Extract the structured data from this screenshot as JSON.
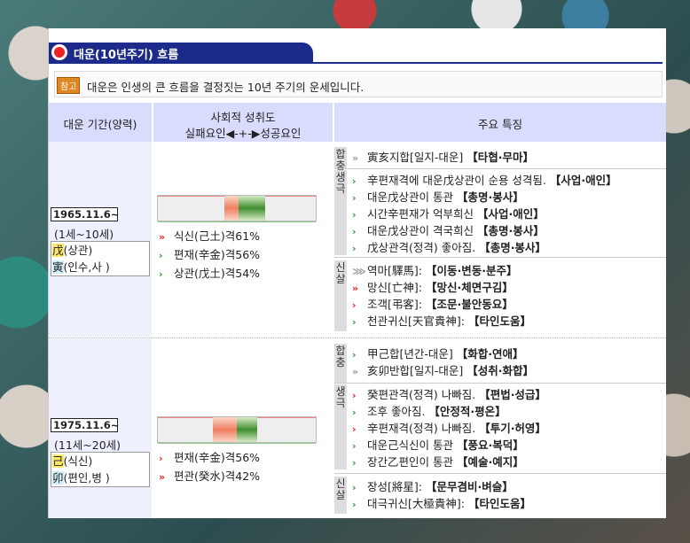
{
  "header": {
    "title": "대운(10년주기) 흐름",
    "notice_tag": "참고",
    "notice_text": "대운은 인생의 큰 흐름을 결정짓는 10년 주기의 운세입니다."
  },
  "columns": {
    "period": "대운 기간(양력)",
    "social_line1": "사회적 성취도",
    "social_line2": "실패요인◀-+-▶성공요인",
    "features": "주요 특징"
  },
  "rows": [
    {
      "date": "1965.11.6~",
      "age": "(1세~10세)",
      "gan_char": "戊",
      "gan_rest": "(상관)",
      "ji_char": "寅",
      "ji_rest": "(인수,사 )",
      "bar": {
        "red_start": 0.42,
        "red_end": 0.51,
        "green_end": 0.68
      },
      "metrics": [
        {
          "arrow": "double-red",
          "text": "식신(己土)격61%"
        },
        {
          "arrow": "green",
          "text": "편재(辛金)격56%"
        },
        {
          "arrow": "green",
          "text": "상관(戊土)격54%"
        }
      ],
      "groups": [
        {
          "label": "합충",
          "items": [
            {
              "arrow": "gray-double",
              "text": "寅亥지합[일지-대운] ",
              "bold": "【타협·무마】"
            }
          ]
        },
        {
          "label": "생극",
          "items": [
            {
              "arrow": "green",
              "text": "辛편재격에 대운戊상관이 순용 성격됨. ",
              "bold": "【사업·애인】"
            },
            {
              "arrow": "green",
              "text": "대운戊상관이 통관 ",
              "bold": "【총명·봉사】"
            },
            {
              "arrow": "green",
              "text": "시간辛편재가 억부희신 ",
              "bold": "【사업·애인】"
            },
            {
              "arrow": "green",
              "text": "대운戊상관이 격국희신 ",
              "bold": "【총명·봉사】"
            },
            {
              "arrow": "green",
              "text": "戊상관격(정격) 좋아짐. ",
              "bold": "【총명·봉사】"
            }
          ]
        },
        {
          "label": "신살",
          "items": [
            {
              "arrow": "gray-triple",
              "text": "역마[驛馬]: ",
              "bold": "【이동·변동·분주】"
            },
            {
              "arrow": "double-red",
              "text": "망신[亡神]: ",
              "bold": "【망신·체면구김】"
            },
            {
              "arrow": "red",
              "text": "조객[弔客]: ",
              "bold": "【조문·불안동요】"
            },
            {
              "arrow": "green",
              "text": "천관귀신[天官貴神]: ",
              "bold": "【타인도움】"
            }
          ]
        }
      ]
    },
    {
      "date": "1975.11.6~",
      "age": "(11세~20세)",
      "gan_char": "己",
      "gan_rest": "(식신)",
      "ji_char": "卯",
      "ji_rest": "(편인,병 )",
      "bar": {
        "red_start": 0.35,
        "red_end": 0.5,
        "green_end": 0.63
      },
      "metrics": [
        {
          "arrow": "red",
          "text": "편재(辛金)격56%"
        },
        {
          "arrow": "double-red",
          "text": "편관(癸水)격42%"
        }
      ],
      "groups": [
        {
          "label": "합충",
          "items": [
            {
              "arrow": "green",
              "text": "甲己합[년간-대운] ",
              "bold": "【화합·연애】"
            },
            {
              "arrow": "gray-double",
              "text": "亥卯반합[일지-대운] ",
              "bold": "【성취·화합】"
            }
          ]
        },
        {
          "label": "생극",
          "items": [
            {
              "arrow": "red",
              "text": "癸편관격(정격) 나빠짐. ",
              "bold": "【편법·성급】"
            },
            {
              "arrow": "green",
              "text": "조후 좋아짐. ",
              "bold": "【안정적·평온】"
            },
            {
              "arrow": "red",
              "text": "辛편재격(정격) 나빠짐. ",
              "bold": "【투기·허영】"
            },
            {
              "arrow": "green",
              "text": "대운己식신이 통관 ",
              "bold": "【풍요·복덕】"
            },
            {
              "arrow": "green",
              "text": "장간乙편인이 통관 ",
              "bold": "【예술·예지】"
            }
          ]
        },
        {
          "label": "신살",
          "items": [
            {
              "arrow": "green",
              "text": "장성[將星]: ",
              "bold": "【문무겸비·벼슬】"
            },
            {
              "arrow": "green",
              "text": "대극귀신[大極貴神]: ",
              "bold": "【타인도움】"
            }
          ]
        }
      ]
    }
  ]
}
